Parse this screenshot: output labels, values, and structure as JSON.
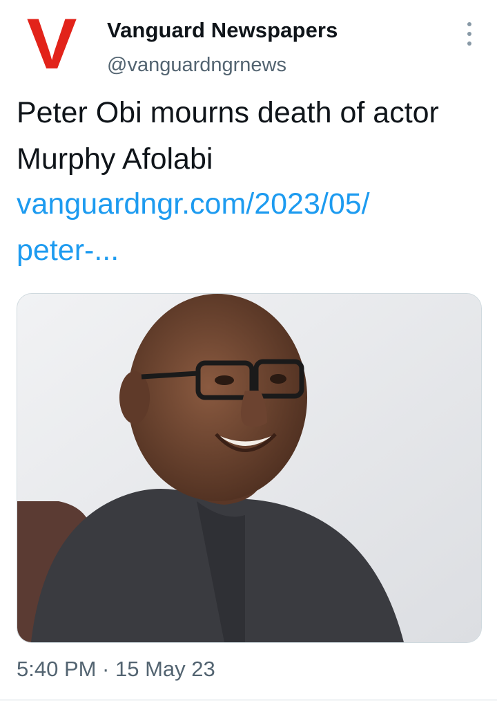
{
  "tweet": {
    "author": {
      "logo_letter": "V",
      "display_name": "Vanguard Newspapers",
      "handle": "@vanguardngrnews"
    },
    "menu_icon": "more-vertical-icon",
    "text": "Peter Obi mourns death of actor Murphy Afolabi",
    "link": "vanguardngr.com/2023/05/\npeter-...",
    "media": {
      "icon": "photo-of-smiling-man-with-glasses"
    },
    "timestamp": "5:40 PM · 15 May 23"
  },
  "colors": {
    "brand": "#e2231a",
    "link": "#1d9bf0",
    "secondary_text": "#536471",
    "border": "#cfd9de"
  }
}
